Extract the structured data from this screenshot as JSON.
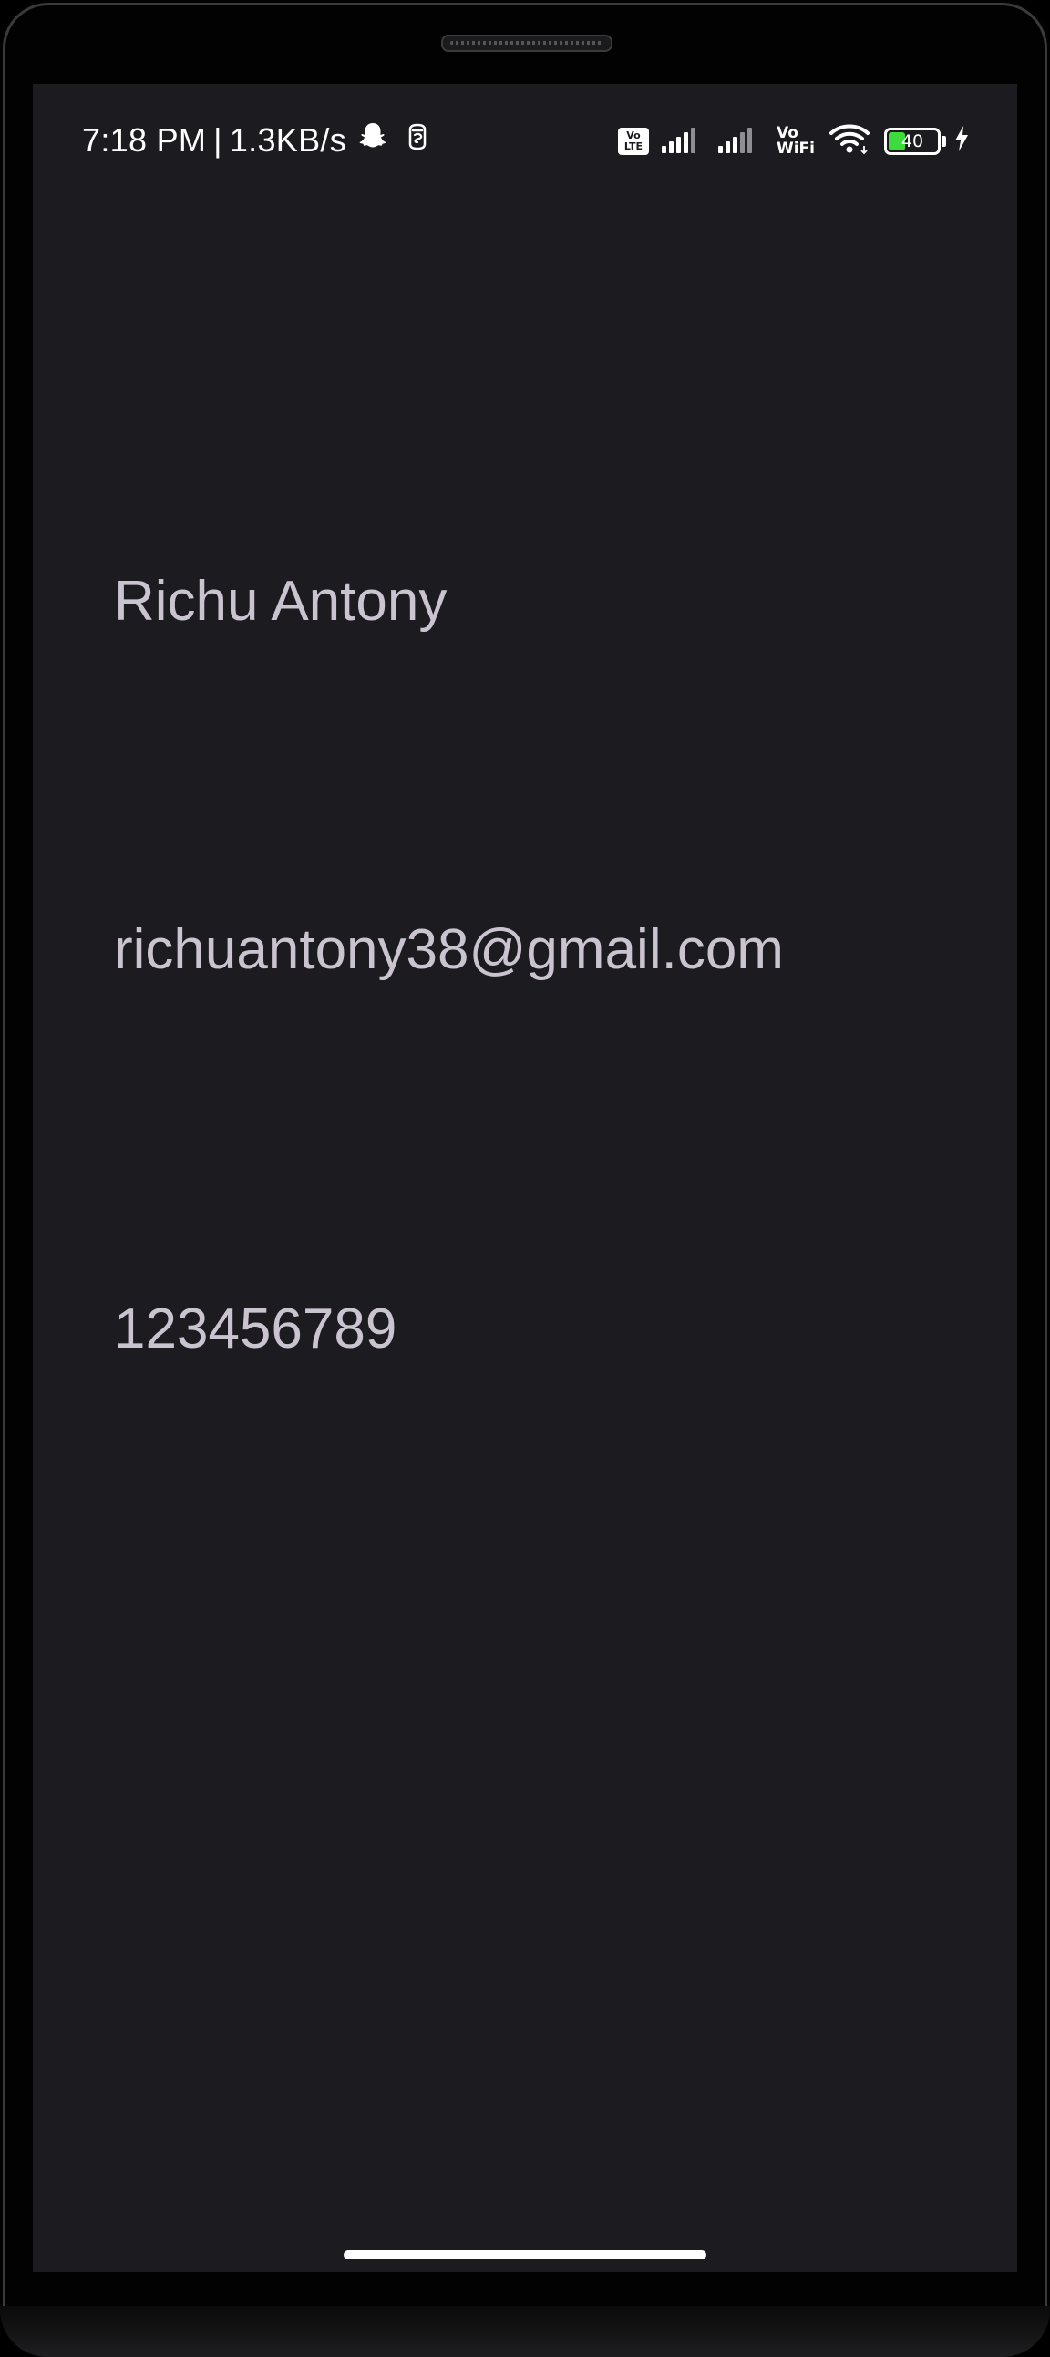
{
  "status_bar": {
    "time": "7:18 PM",
    "separator": "|",
    "network_speed": "1.3KB/s",
    "left_icons": [
      "snapchat-icon",
      "notification-app-icon"
    ],
    "volte_label_top": "Vo",
    "volte_label_bottom": "LTE",
    "vowifi_label_top": "Vo",
    "vowifi_label_bottom": "WiFi",
    "battery_level": "40",
    "battery_fraction": 0.4,
    "battery_color": "#3ddc3d",
    "charging": true
  },
  "profile": {
    "name": "Richu Antony",
    "email": "richuantony38@gmail.com",
    "phone": "123456789"
  },
  "colors": {
    "screen_background": "#1c1b1f",
    "text": "#cac4d0"
  }
}
